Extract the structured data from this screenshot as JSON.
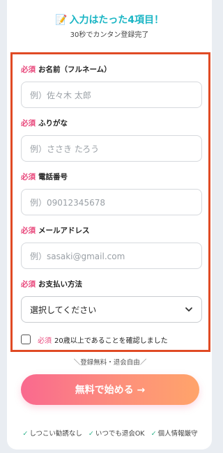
{
  "header": {
    "title": "入力はたった4項目！",
    "subtitle": "30秒でカンタン登録完了"
  },
  "form": {
    "required_label": "必須",
    "fields": [
      {
        "label": "お名前（フルネーム）",
        "placeholder": "例）佐々木 太郎"
      },
      {
        "label": "ふりがな",
        "placeholder": "例）ささき たろう"
      },
      {
        "label": "電話番号",
        "placeholder": "例）09012345678"
      },
      {
        "label": "メールアドレス",
        "placeholder": "例）sasaki@gmail.com"
      }
    ],
    "payment": {
      "label": "お支払い方法",
      "selected": "選択してください"
    },
    "confirm": {
      "required": "必須",
      "text": "20歳以上であることを確認しました"
    }
  },
  "free_note": "＼登録無料・退会自由／",
  "cta_label": "無料で始める →",
  "assurances": [
    {
      "check": "✓",
      "text": "しつこい勧誘なし"
    },
    {
      "check": "✓",
      "text": "いつでも退会OK"
    },
    {
      "check": "✓",
      "text": "個人情報厳守"
    }
  ],
  "colors": {
    "accent_teal": "#1ab5c4",
    "required_pink": "#e8467a",
    "frame_red": "#e04a24",
    "cta_start": "#f9698f",
    "cta_end": "#ffa46a",
    "check_green": "#2cb28a"
  },
  "icons": [
    "memo-icon",
    "chevron-down-icon",
    "check-icon"
  ]
}
